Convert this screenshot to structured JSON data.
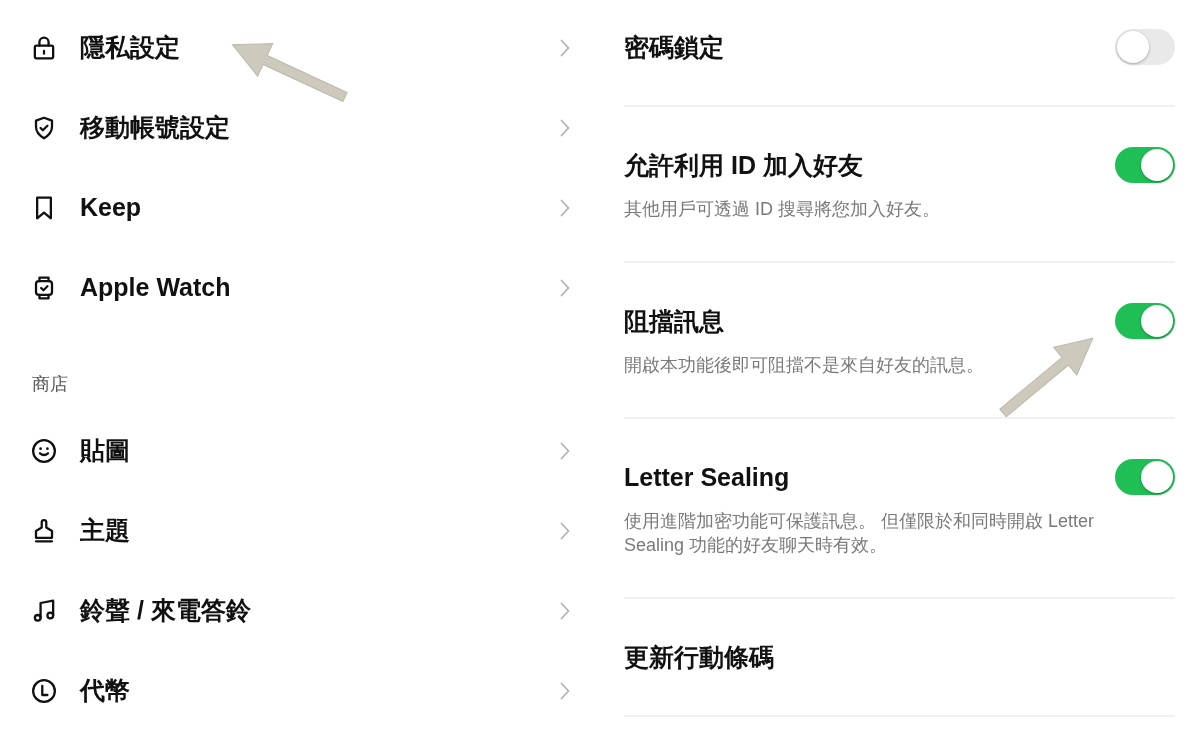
{
  "settings_list": {
    "groups": [
      {
        "items": [
          {
            "label": "隱私設定"
          },
          {
            "label": "移動帳號設定"
          },
          {
            "label": "Keep"
          },
          {
            "label": "Apple Watch"
          }
        ]
      },
      {
        "header": "商店",
        "items": [
          {
            "label": "貼圖"
          },
          {
            "label": "主題"
          },
          {
            "label": "鈴聲 / 來電答鈴"
          },
          {
            "label": "代幣"
          }
        ]
      }
    ]
  },
  "privacy_settings": {
    "rows": [
      {
        "kind": "toggle",
        "title": "密碼鎖定",
        "on": false
      },
      {
        "kind": "toggle",
        "title": "允許利用 ID 加入好友",
        "description": "其他用戶可透過 ID 搜尋將您加入好友。",
        "on": true
      },
      {
        "kind": "toggle",
        "title": "阻擋訊息",
        "description": "開啟本功能後即可阻擋不是來自好友的訊息。",
        "on": true
      },
      {
        "kind": "toggle",
        "title": "Letter Sealing",
        "description": "使用進階加密功能可保護訊息。 但僅限於和同時開啟 Letter Sealing 功能的好友聊天時有效。",
        "on": true
      },
      {
        "kind": "action",
        "title": "更新行動條碼"
      }
    ]
  }
}
